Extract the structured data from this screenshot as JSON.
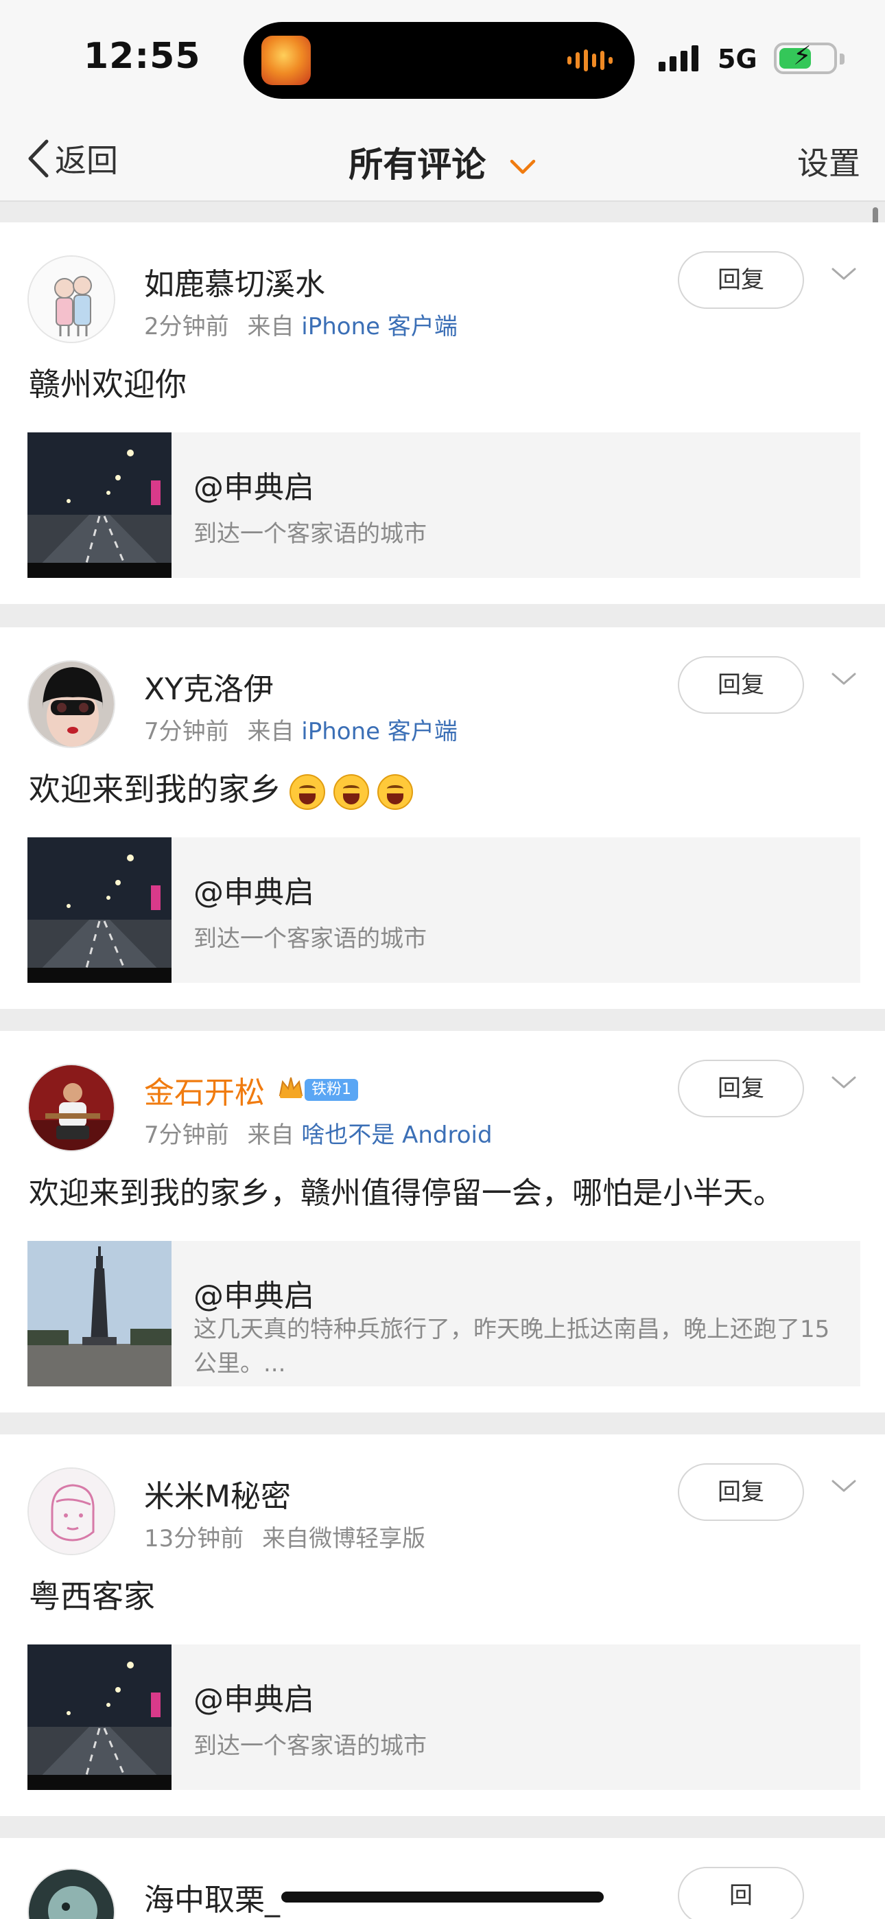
{
  "status": {
    "time": "12:55",
    "network": "5G",
    "battery_level": 0.6
  },
  "nav": {
    "back_label": "返回",
    "title": "所有评论",
    "settings_label": "设置"
  },
  "comments": [
    {
      "username": "如鹿慕切溪水",
      "time": "2分钟前",
      "from_prefix": "来自",
      "source": "iPhone 客户端",
      "text": "赣州欢迎你",
      "reply_label": "回复",
      "repost": {
        "user": "@申典启",
        "text": "到达一个客家语的城市"
      }
    },
    {
      "username": "XY克洛伊",
      "time": "7分钟前",
      "from_prefix": "来自",
      "source": "iPhone 客户端",
      "text": "欢迎来到我的家乡",
      "emoji_icons": [
        "laughing-emoji-icon",
        "laughing-emoji-icon",
        "laughing-emoji-icon"
      ],
      "reply_label": "回复",
      "repost": {
        "user": "@申典启",
        "text": "到达一个客家语的城市"
      }
    },
    {
      "username": "金石开松",
      "badge": "铁粉1",
      "time": "7分钟前",
      "from_prefix": "来自",
      "source": "啥也不是 Android",
      "text": "欢迎来到我的家乡，赣州值得停留一会，哪怕是小半天。",
      "reply_label": "回复",
      "repost": {
        "user": "@申典启",
        "text": "这几天真的特种兵旅行了，昨天晚上抵达南昌，晚上还跑了15公里。..."
      }
    },
    {
      "username": "米米M秘密",
      "time": "13分钟前",
      "from_prefix": "来自微博轻享版",
      "source": "",
      "text": "粤西客家",
      "reply_label": "回复",
      "repost": {
        "user": "@申典启",
        "text": "到达一个客家语的城市"
      }
    },
    {
      "username": "海中取栗_",
      "reply_label": "回"
    }
  ],
  "colors": {
    "accent_orange": "#f07b0f",
    "link_blue": "#3b6fb6",
    "badge_blue": "#5aa6f4"
  }
}
